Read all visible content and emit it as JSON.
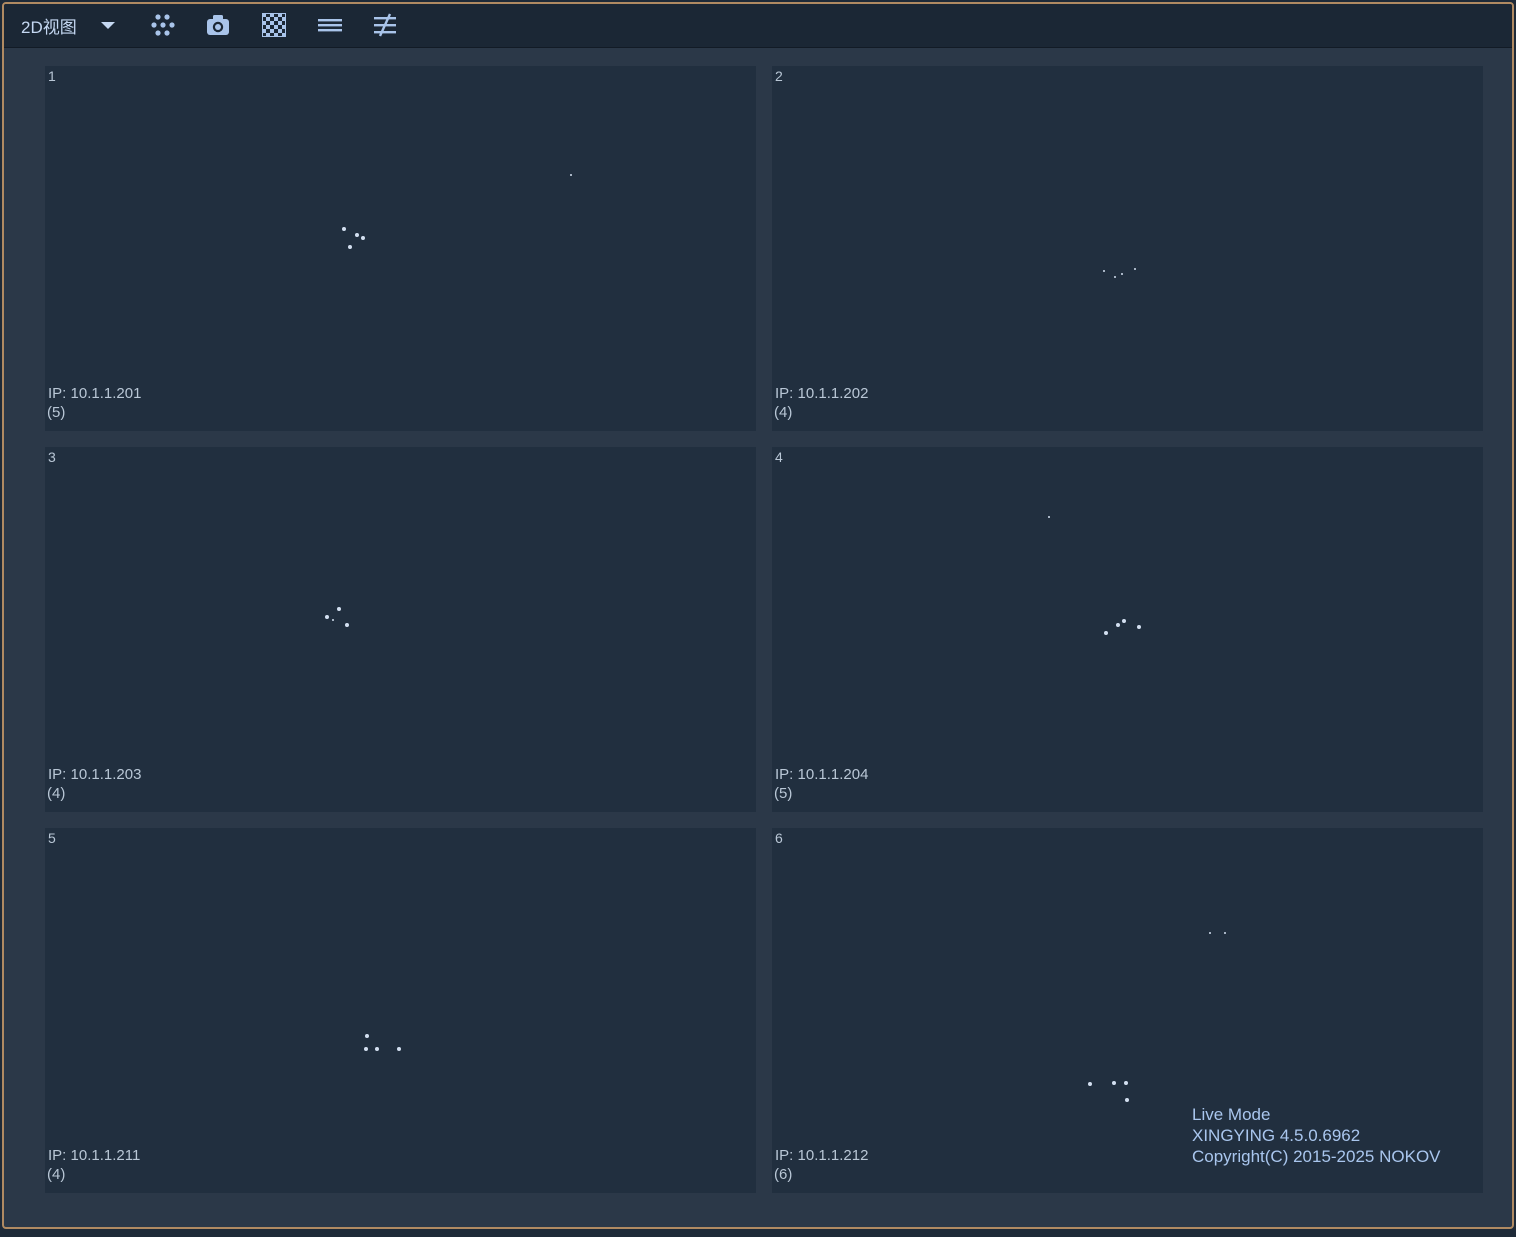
{
  "toolbar": {
    "view_mode": "2D视图",
    "icons": [
      "chevron-down-icon",
      "markers-icon",
      "camera-icon",
      "checkerboard-icon",
      "lines-icon",
      "not-equal-icon"
    ],
    "accent_color": "#a9c4ea"
  },
  "cameras": [
    {
      "num": "1",
      "ip": "IP: 10.1.1.201",
      "count": "(5)"
    },
    {
      "num": "2",
      "ip": "IP: 10.1.1.202",
      "count": "(4)"
    },
    {
      "num": "3",
      "ip": "IP: 10.1.1.203",
      "count": "(4)"
    },
    {
      "num": "4",
      "ip": "IP: 10.1.1.204",
      "count": "(5)"
    },
    {
      "num": "5",
      "ip": "IP: 10.1.1.211",
      "count": "(4)"
    },
    {
      "num": "6",
      "ip": "IP: 10.1.1.212",
      "count": "(6)"
    }
  ],
  "status": {
    "mode": "Live Mode",
    "version": "XINGYING 4.5.0.6962",
    "copyright": "Copyright(C) 2015-2025 NOKOV"
  },
  "colors": {
    "frame_border": "#b08a62",
    "panel_bg": "#212f3f",
    "marker": "#d3dff0"
  }
}
